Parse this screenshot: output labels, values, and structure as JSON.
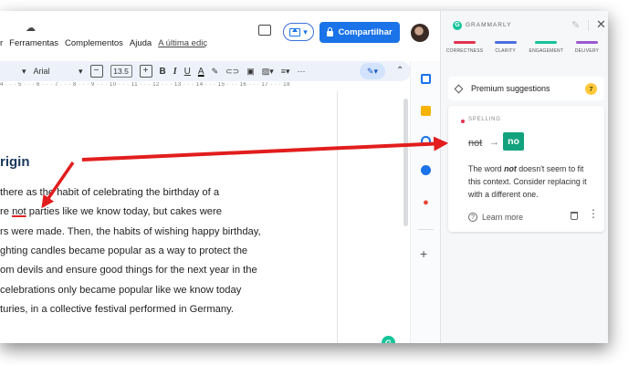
{
  "docs": {
    "menu": [
      "r",
      "Ferramentas",
      "Complementos",
      "Ajuda"
    ],
    "last_edit": "A última ediç",
    "share_label": "Compartilhar",
    "toolbar": {
      "font": "Arial",
      "font_size": "13.5",
      "minus": "−",
      "plus": "+",
      "bold": "B",
      "italic": "I",
      "underline": "U",
      "text_color": "A",
      "more": "···"
    },
    "ruler": "4 · · · 5 · · · 6 · · · 7 · · · 8 · · · 9 · · · 10 · · · 11 · · · 12 · · · 13 · · · 14 · · · 15 · · · 16 · · · 17 · · · 18",
    "heading": "rigin",
    "paragraph": [
      {
        "pre": "there ",
        "err": "",
        "post": "as the habit of celebrating the birthday of a"
      },
      {
        "pre": "re ",
        "err": "not",
        "post": " parties like we know today, but cakes were"
      },
      {
        "pre": "rs were made. Then, the habits of wishing happy birthday,",
        "err": "",
        "post": ""
      },
      {
        "pre": "ghting candles became popular as a way to protect the",
        "err": "",
        "post": ""
      },
      {
        "pre": "om devils and ensure good things for the next year in the",
        "err": "",
        "post": ""
      },
      {
        "pre": "celebrations only became popular like we know today",
        "err": "",
        "post": ""
      },
      {
        "pre": "turies, in a collective festival performed in Germany.",
        "err": "",
        "post": ""
      }
    ]
  },
  "grammarly": {
    "title": "GRAMMARLY",
    "logo_letter": "G",
    "categories": [
      {
        "label": "CORRECTNESS",
        "color": "#e0324e"
      },
      {
        "label": "CLARITY",
        "color": "#4a6ee0"
      },
      {
        "label": "ENGAGEMENT",
        "color": "#15c39a"
      },
      {
        "label": "DELIVERY",
        "color": "#9b59d0"
      }
    ],
    "premium_label": "Premium suggestions",
    "premium_count": "7",
    "card": {
      "category": "SPELLING",
      "original": "not",
      "arrow": "→",
      "replacement": "no",
      "expl_pre": "The word ",
      "expl_word": "not",
      "expl_post": " doesn't seem to fit this context. Consider replacing it with a different one.",
      "learn_more": "Learn more"
    }
  },
  "colors": {
    "share_blue": "#1a73e8",
    "grammarly_green": "#15c39a",
    "accept_green": "#13a27e",
    "annotation_red": "#e21d1d"
  }
}
